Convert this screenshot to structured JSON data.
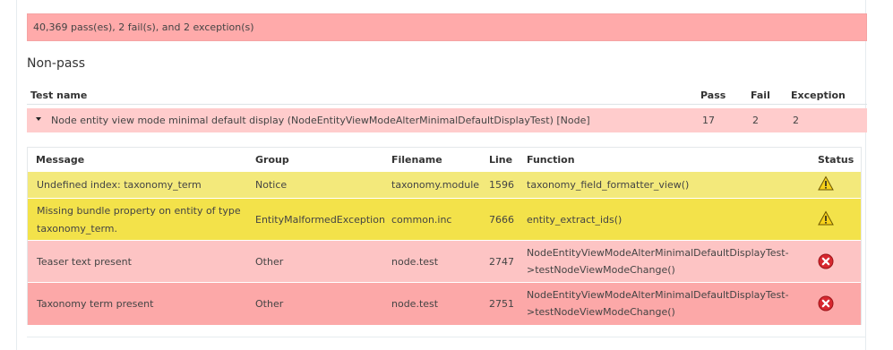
{
  "summary": "40,369 pass(es), 2 fail(s), and 2 exception(s)",
  "heading": "Non-pass",
  "outer_table": {
    "headers": {
      "test_name": "Test name",
      "pass": "Pass",
      "fail": "Fail",
      "exception": "Exception"
    },
    "row": {
      "name": "Node entity view mode minimal default display (NodeEntityViewModeAlterMinimalDefaultDisplayTest) [Node]",
      "pass": "17",
      "fail": "2",
      "exception": "2"
    }
  },
  "inner_table": {
    "headers": {
      "message": "Message",
      "group": "Group",
      "filename": "Filename",
      "line": "Line",
      "function": "Function",
      "status": "Status"
    },
    "rows": [
      {
        "message_1": "Undefined index: taxonomy_term",
        "message_2": "",
        "group": "Notice",
        "filename": "taxonomy.module",
        "line": "1596",
        "function_1": "taxonomy_field_formatter_view()",
        "function_2": "",
        "status": "warning"
      },
      {
        "message_1": "Missing bundle property on entity of type",
        "message_2": "taxonomy_term.",
        "group": "EntityMalformedException",
        "filename": "common.inc",
        "line": "7666",
        "function_1": "entity_extract_ids()",
        "function_2": "",
        "status": "warning"
      },
      {
        "message_1": "Teaser text present",
        "message_2": "",
        "group": "Other",
        "filename": "node.test",
        "line": "2747",
        "function_1": "NodeEntityViewModeAlterMinimalDefaultDisplayTest-",
        "function_2": ">testNodeViewModeChange()",
        "status": "error"
      },
      {
        "message_1": "Taxonomy term present",
        "message_2": "",
        "group": "Other",
        "filename": "node.test",
        "line": "2751",
        "function_1": "NodeEntityViewModeAlterMinimalDefaultDisplayTest-",
        "function_2": ">testNodeViewModeChange()",
        "status": "error"
      }
    ]
  },
  "colors": {
    "summary_bg": "#ffaaaa",
    "warning_light": "#f3e97b",
    "warning_dark": "#f3e24a",
    "error_light": "#fdc4c4",
    "error_dark": "#fca8a8"
  }
}
